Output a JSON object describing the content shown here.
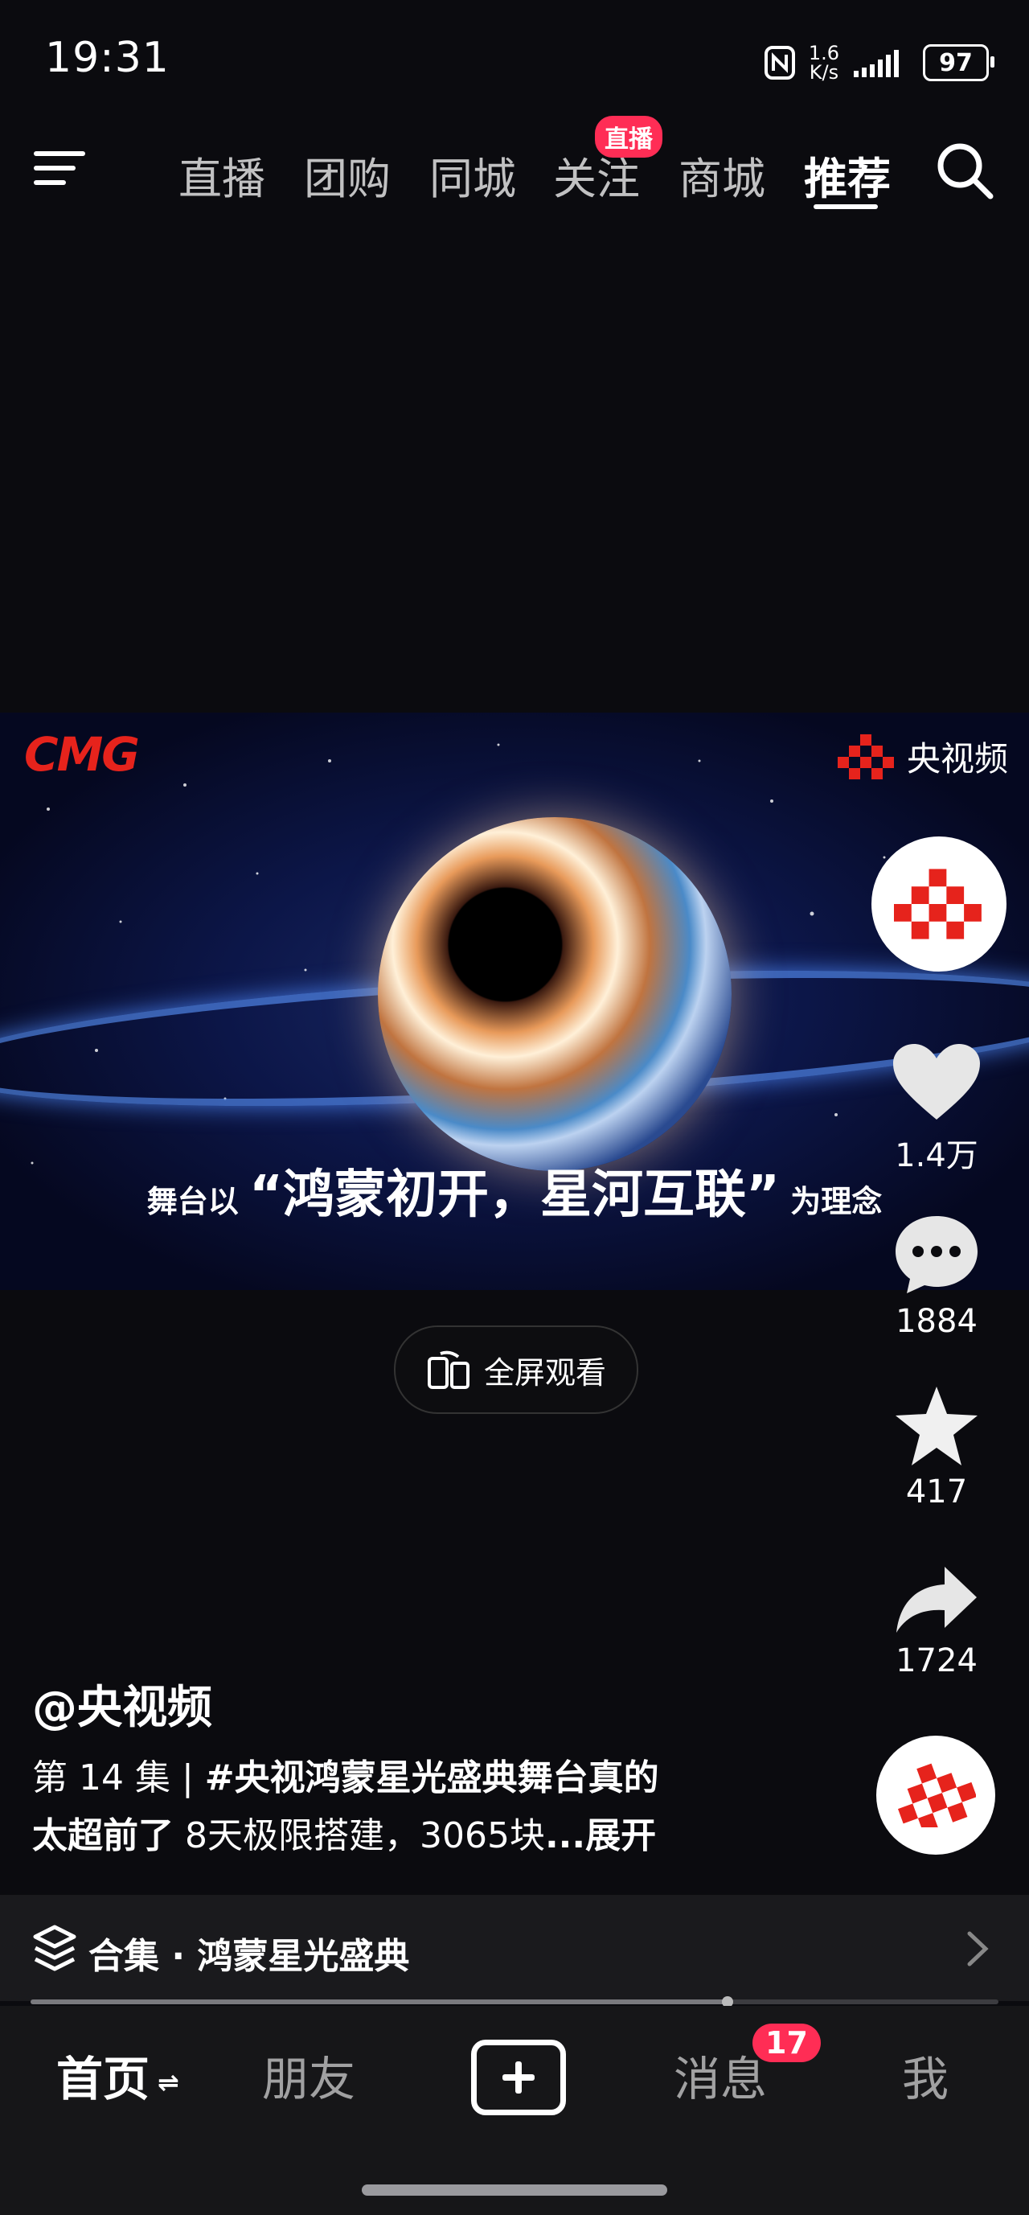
{
  "status_bar": {
    "time": "19:31",
    "net_speed_value": "1.6",
    "net_speed_unit": "K/s",
    "battery": "97"
  },
  "top_nav": {
    "tabs": [
      "直播",
      "团购",
      "同城",
      "关注",
      "商城",
      "推荐"
    ],
    "active_tab": "推荐",
    "follow_badge": "直播"
  },
  "video": {
    "cmg_logo": "CMG",
    "watermark": "央视频",
    "caption_prefix": "舞台以",
    "caption_main": "“鸿蒙初开，星河互联”",
    "caption_suffix": "为理念"
  },
  "fullscreen_button": {
    "label": "全屏观看"
  },
  "sidebar": {
    "likes": "1.4万",
    "comments": "1884",
    "favorites": "417",
    "shares": "1724"
  },
  "post": {
    "author": "@央视频",
    "episode": "第 14 集 | ",
    "hashtag_part1": "#央视鸿蒙星光盛典舞台真的",
    "hashtag_part2": "太超前了",
    "text": "  8天极限搭建，3065块",
    "expand": "...展开"
  },
  "collection": {
    "label": "合集 · 鸿蒙星光盛典"
  },
  "playback": {
    "progress": 0.72
  },
  "bottom_nav": {
    "home": "首页",
    "friends": "朋友",
    "messages": "消息",
    "messages_badge": "17",
    "me": "我"
  },
  "colors": {
    "accent": "#ff2d55",
    "brand_red": "#e6231c",
    "background": "#0b0b0f"
  }
}
